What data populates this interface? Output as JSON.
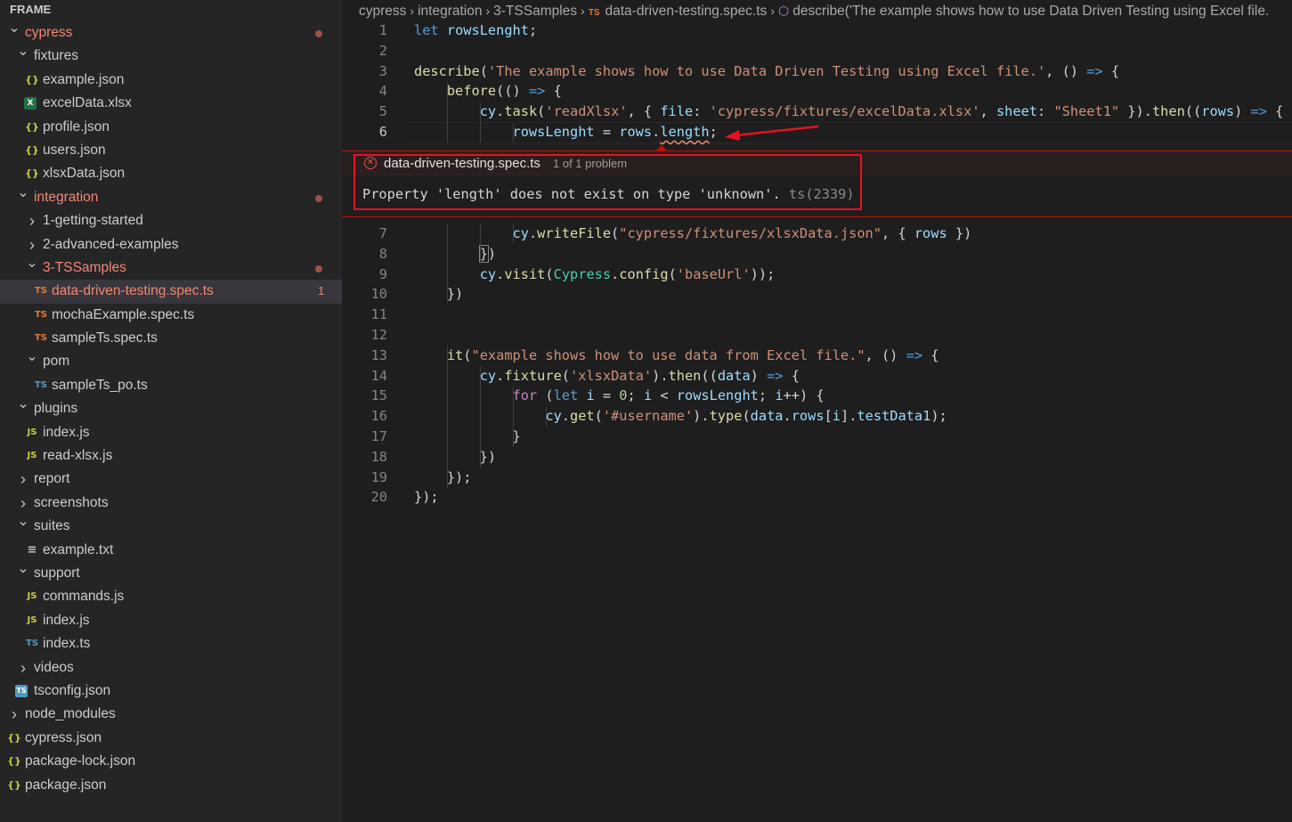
{
  "explorer": {
    "header": "FRAME",
    "items": [
      {
        "label": "cypress",
        "depth": 0,
        "kind": "folder-open",
        "icon": "chevron-down-icon",
        "error": true,
        "dot": true
      },
      {
        "label": "fixtures",
        "depth": 1,
        "kind": "folder-open",
        "icon": "chevron-down-icon"
      },
      {
        "label": "example.json",
        "depth": 2,
        "kind": "file",
        "icon": "json-file-icon",
        "icon_text": "{}",
        "icon_class": "ic-json"
      },
      {
        "label": "excelData.xlsx",
        "depth": 2,
        "kind": "file",
        "icon": "excel-file-icon",
        "icon_text": "X",
        "icon_class": "ic-xlsx"
      },
      {
        "label": "profile.json",
        "depth": 2,
        "kind": "file",
        "icon": "json-file-icon",
        "icon_text": "{}",
        "icon_class": "ic-json"
      },
      {
        "label": "users.json",
        "depth": 2,
        "kind": "file",
        "icon": "json-file-icon",
        "icon_text": "{}",
        "icon_class": "ic-json"
      },
      {
        "label": "xlsxData.json",
        "depth": 2,
        "kind": "file",
        "icon": "json-file-icon",
        "icon_text": "{}",
        "icon_class": "ic-json"
      },
      {
        "label": "integration",
        "depth": 1,
        "kind": "folder-open",
        "icon": "chevron-down-icon",
        "error": true,
        "dot": true
      },
      {
        "label": "1-getting-started",
        "depth": 2,
        "kind": "folder",
        "icon": "chevron-right-icon"
      },
      {
        "label": "2-advanced-examples",
        "depth": 2,
        "kind": "folder",
        "icon": "chevron-right-icon"
      },
      {
        "label": "3-TSSamples",
        "depth": 2,
        "kind": "folder-open",
        "icon": "chevron-down-icon",
        "error": true,
        "dot": true
      },
      {
        "label": "data-driven-testing.spec.ts",
        "depth": 3,
        "kind": "file",
        "icon": "typescript-file-icon",
        "icon_text": "TS",
        "icon_class": "ic-ts",
        "error": true,
        "selected": true,
        "count": "1"
      },
      {
        "label": "mochaExample.spec.ts",
        "depth": 3,
        "kind": "file",
        "icon": "typescript-file-icon",
        "icon_text": "TS",
        "icon_class": "ic-ts"
      },
      {
        "label": "sampleTs.spec.ts",
        "depth": 3,
        "kind": "file",
        "icon": "typescript-file-icon",
        "icon_text": "TS",
        "icon_class": "ic-ts"
      },
      {
        "label": "pom",
        "depth": 2,
        "kind": "folder-open",
        "icon": "chevron-down-icon"
      },
      {
        "label": "sampleTs_po.ts",
        "depth": 3,
        "kind": "file",
        "icon": "typescript-file-icon",
        "icon_text": "TS",
        "icon_class": "ic-ts-blue"
      },
      {
        "label": "plugins",
        "depth": 1,
        "kind": "folder-open",
        "icon": "chevron-down-icon"
      },
      {
        "label": "index.js",
        "depth": 2,
        "kind": "file",
        "icon": "javascript-file-icon",
        "icon_text": "JS",
        "icon_class": "ic-js"
      },
      {
        "label": "read-xlsx.js",
        "depth": 2,
        "kind": "file",
        "icon": "javascript-file-icon",
        "icon_text": "JS",
        "icon_class": "ic-js"
      },
      {
        "label": "report",
        "depth": 1,
        "kind": "folder",
        "icon": "chevron-right-icon"
      },
      {
        "label": "screenshots",
        "depth": 1,
        "kind": "folder",
        "icon": "chevron-right-icon"
      },
      {
        "label": "suites",
        "depth": 1,
        "kind": "folder-open",
        "icon": "chevron-down-icon"
      },
      {
        "label": "example.txt",
        "depth": 2,
        "kind": "file",
        "icon": "text-file-icon",
        "icon_text": "≡",
        "icon_class": "ic-txt"
      },
      {
        "label": "support",
        "depth": 1,
        "kind": "folder-open",
        "icon": "chevron-down-icon"
      },
      {
        "label": "commands.js",
        "depth": 2,
        "kind": "file",
        "icon": "javascript-file-icon",
        "icon_text": "JS",
        "icon_class": "ic-js"
      },
      {
        "label": "index.js",
        "depth": 2,
        "kind": "file",
        "icon": "javascript-file-icon",
        "icon_text": "JS",
        "icon_class": "ic-js"
      },
      {
        "label": "index.ts",
        "depth": 2,
        "kind": "file",
        "icon": "typescript-file-icon",
        "icon_text": "TS",
        "icon_class": "ic-ts-blue"
      },
      {
        "label": "videos",
        "depth": 1,
        "kind": "folder",
        "icon": "chevron-right-icon"
      },
      {
        "label": "tsconfig.json",
        "depth": 1,
        "kind": "file",
        "icon": "tsconfig-file-icon",
        "icon_text": "TS",
        "icon_class": "ic-tsconfig"
      },
      {
        "label": "node_modules",
        "depth": 0,
        "kind": "folder",
        "icon": "chevron-right-icon"
      },
      {
        "label": "cypress.json",
        "depth": 0,
        "kind": "file",
        "icon": "json-file-icon",
        "icon_text": "{}",
        "icon_class": "ic-json"
      },
      {
        "label": "package-lock.json",
        "depth": 0,
        "kind": "file",
        "icon": "json-file-icon",
        "icon_text": "{}",
        "icon_class": "ic-json"
      },
      {
        "label": "package.json",
        "depth": 0,
        "kind": "file",
        "icon": "json-file-icon",
        "icon_text": "{}",
        "icon_class": "ic-json"
      }
    ]
  },
  "breadcrumb": {
    "parts": [
      "cypress",
      "integration",
      "3-TSSamples"
    ],
    "file_badge": "TS",
    "file": "data-driven-testing.spec.ts",
    "symbol": "describe('The example shows how to use Data Driven Testing using Excel file."
  },
  "problem": {
    "file": "data-driven-testing.spec.ts",
    "count": "1 of 1 problem",
    "message": "Property 'length' does not exist on type 'unknown'.",
    "code": "ts(2339)"
  },
  "editor": {
    "active_line": 6,
    "lines_before": [
      {
        "n": "1",
        "html": "<span class=\"k\">let</span> <span class=\"v\">rowsLenght</span>;"
      },
      {
        "n": "2",
        "html": ""
      },
      {
        "n": "3",
        "html": "<span class=\"f\">describe</span>(<span class=\"s\">'The example shows how to use Data Driven Testing using Excel file.'</span>, () <span class=\"k\">=&gt;</span> {"
      },
      {
        "n": "4",
        "html": "    <span class=\"f\">before</span>(() <span class=\"k\">=&gt;</span> {"
      },
      {
        "n": "5",
        "html": "        <span class=\"v\">cy</span>.<span class=\"f\">task</span>(<span class=\"s\">'readXlsx'</span>, { <span class=\"v\">file</span>: <span class=\"s\">'cypress/fixtures/excelData.xlsx'</span>, <span class=\"v\">sheet</span>: <span class=\"s\">\"Sheet1\"</span> }).<span class=\"f\">then</span>((<span class=\"v\">rows</span>) <span class=\"k\">=&gt;</span> {"
      },
      {
        "n": "6",
        "html": "            <span class=\"v\">rowsLenght</span> = <span class=\"v\">rows</span>.<span class=\"v squig\">length</span>;"
      }
    ],
    "lines_after": [
      {
        "n": "7",
        "html": "            <span class=\"v\">cy</span>.<span class=\"f\">writeFile</span>(<span class=\"s\">\"cypress/fixtures/xlsxData.json\"</span>, { <span class=\"v\">rows</span> })"
      },
      {
        "n": "8",
        "html": "        <span class=\"bracket-box\">}</span>)"
      },
      {
        "n": "9",
        "html": "        <span class=\"v\">cy</span>.<span class=\"f\">visit</span>(<span class=\"t\">Cypress</span>.<span class=\"f\">config</span>(<span class=\"s\">'baseUrl'</span>));"
      },
      {
        "n": "10",
        "html": "    })"
      },
      {
        "n": "11",
        "html": ""
      },
      {
        "n": "12",
        "html": ""
      },
      {
        "n": "13",
        "html": "    <span class=\"f\">it</span>(<span class=\"s\">\"example shows how to use data from Excel file.\"</span>, () <span class=\"k\">=&gt;</span> {"
      },
      {
        "n": "14",
        "html": "        <span class=\"v\">cy</span>.<span class=\"f\">fixture</span>(<span class=\"s\">'xlsxData'</span>).<span class=\"f\">then</span>((<span class=\"v\">data</span>) <span class=\"k\">=&gt;</span> {"
      },
      {
        "n": "15",
        "html": "            <span class=\"kc\">for</span> (<span class=\"k\">let</span> <span class=\"v\">i</span> = <span class=\"n\">0</span>; <span class=\"v\">i</span> &lt; <span class=\"v\">rowsLenght</span>; <span class=\"v\">i</span>++) {"
      },
      {
        "n": "16",
        "html": "                <span class=\"v\">cy</span>.<span class=\"f\">get</span>(<span class=\"s\">'#username'</span>).<span class=\"f\">type</span>(<span class=\"v\">data</span>.<span class=\"v\">rows</span>[<span class=\"v\">i</span>].<span class=\"v\">testData1</span>);"
      },
      {
        "n": "17",
        "html": "            }"
      },
      {
        "n": "18",
        "html": "        })"
      },
      {
        "n": "19",
        "html": "    });"
      },
      {
        "n": "20",
        "html": "});"
      }
    ]
  },
  "colors": {
    "accent_error": "#f48771",
    "annotation_red": "#e81123",
    "sidebar_bg": "#252526",
    "editor_bg": "#1e1e1e",
    "selection_bg": "#37373d"
  }
}
